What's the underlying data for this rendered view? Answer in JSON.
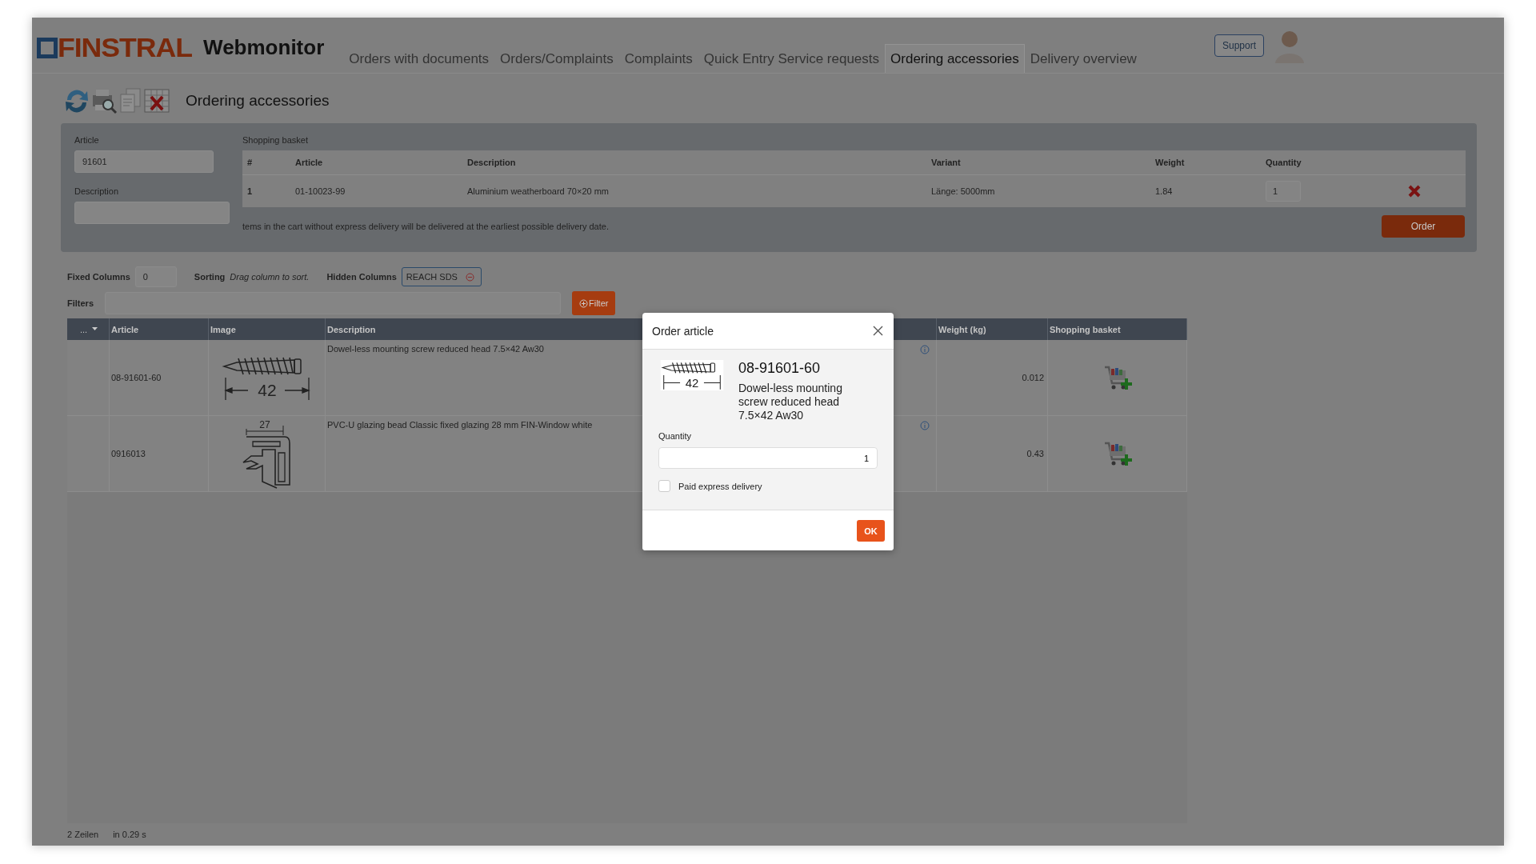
{
  "header": {
    "logo": "FINSTRAL",
    "app_name": "Webmonitor",
    "support_button": "Support",
    "nav": [
      {
        "label": "Orders with documents",
        "selected": false
      },
      {
        "label": "Orders/Complaints",
        "selected": false
      },
      {
        "label": "Complaints",
        "selected": false
      },
      {
        "label": "Quick Entry Service requests",
        "selected": false
      },
      {
        "label": "Ordering accessories",
        "selected": true
      },
      {
        "label": "Delivery overview",
        "selected": false
      }
    ]
  },
  "toolbar": {
    "title": "Ordering accessories"
  },
  "search": {
    "article_label": "Article",
    "article_value": "91601",
    "description_label": "Description"
  },
  "basket": {
    "title": "Shopping basket",
    "columns": [
      "#",
      "Article",
      "Description",
      "Variant",
      "Weight",
      "Quantity"
    ],
    "rows": [
      {
        "number": "1",
        "article": "01-10023-99",
        "description": "Aluminium weatherboard 70×20 mm",
        "variant": "Länge: 5000mm",
        "weight": "1.84",
        "quantity": "1"
      }
    ],
    "note": "tems in the cart without express delivery will be delivered at the earliest possible delivery date.",
    "order_button": "Order"
  },
  "options": {
    "fixed_columns_label": "Fixed Columns",
    "fixed_columns_value": "0",
    "sorting_label": "Sorting",
    "sorting_hint": "Drag column to sort.",
    "hidden_columns_label": "Hidden Columns",
    "hidden_column_tag": "REACH SDS",
    "filters_label": "Filters",
    "filter_button": "Filter"
  },
  "table": {
    "menu": "...",
    "columns": [
      "Article",
      "Image",
      "Description",
      "Weight (kg)",
      "Shopping basket"
    ],
    "rows": [
      {
        "article": "08-91601-60",
        "image": {
          "kind": "screw",
          "dimension": "42"
        },
        "description": "Dowel-less mounting screw reduced head 7.5×42 Aw30",
        "weight": "0.012"
      },
      {
        "article": "0916013",
        "image": {
          "kind": "profile",
          "dimension": "27"
        },
        "description": "PVC-U glazing bead Classic fixed glazing 28 mm FIN-Window white",
        "weight": "0.43"
      }
    ]
  },
  "status_bar": {
    "rows": "2 Zeilen",
    "time": "in 0.29 s"
  },
  "dialog": {
    "title": "Order article",
    "article": "08-91601-60",
    "description": "Dowel-less mounting screw reduced head 7.5×42 Aw30",
    "image": {
      "kind": "screw",
      "dimension": "42"
    },
    "quantity_label": "Quantity",
    "quantity_value": "1",
    "express_label": "Paid express delivery",
    "express_checked": false,
    "ok_button": "OK"
  }
}
